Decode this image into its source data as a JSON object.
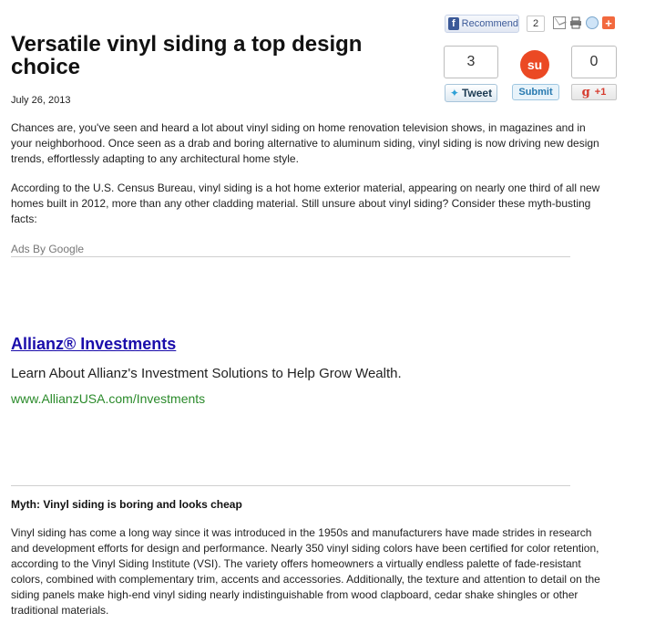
{
  "article": {
    "title": "Versatile vinyl siding a top design choice",
    "date": "July 26, 2013",
    "paragraph1": "Chances are, you've seen and heard a lot about vinyl siding on home renovation television shows, in magazines and in your neighborhood. Once seen as a drab and boring alternative to aluminum siding, vinyl siding is now driving new design trends, effortlessly adapting to any architectural home style.",
    "paragraph2": "According to the U.S. Census Bureau, vinyl siding is a hot home exterior material, appearing on nearly one third of all new homes built in 2012, more than any other cladding material. Still unsure about vinyl siding? Consider these myth-busting facts:",
    "myth_heading": "Myth: Vinyl siding is boring and looks cheap",
    "paragraph3": "Vinyl siding has come a long way since it was introduced in the 1950s and manufacturers have made strides in research and development efforts for design and performance. Nearly 350 vinyl siding colors have been certified for color retention, according to the Vinyl Siding Institute (VSI). The variety offers homeowners a virtually endless palette of fade-resistant colors, combined with complementary trim, accents and accessories. Additionally, the texture and attention to detail on the siding panels make high-end vinyl siding nearly indistinguishable from wood clapboard, cedar shake shingles or other traditional materials."
  },
  "ads": {
    "label": "Ads By Google",
    "title": "Allianz® Investments",
    "description": "Learn About Allianz's Investment Solutions to Help Grow Wealth.",
    "url": "www.AllianzUSA.com/Investments"
  },
  "share": {
    "facebook_label": "Recommend",
    "facebook_logo": "f",
    "facebook_count": "2",
    "tweet_count": "3",
    "tweet_label": "Tweet",
    "stumble_logo": "su",
    "submit_label": "Submit",
    "gplus_count": "0",
    "gplus_letter": "g",
    "gplus_label": "+1",
    "addthis_plus": "+"
  },
  "icons": {
    "email": "envelope-icon",
    "print": "printer-icon",
    "reddit": "reddit-icon",
    "twitter": "bird-icon"
  },
  "colors": {
    "ad_link": "#1a0dab",
    "ad_url": "#2a8a2a",
    "facebook": "#3b5998",
    "stumbleupon": "#eb4924",
    "addthis": "#f2693e"
  }
}
